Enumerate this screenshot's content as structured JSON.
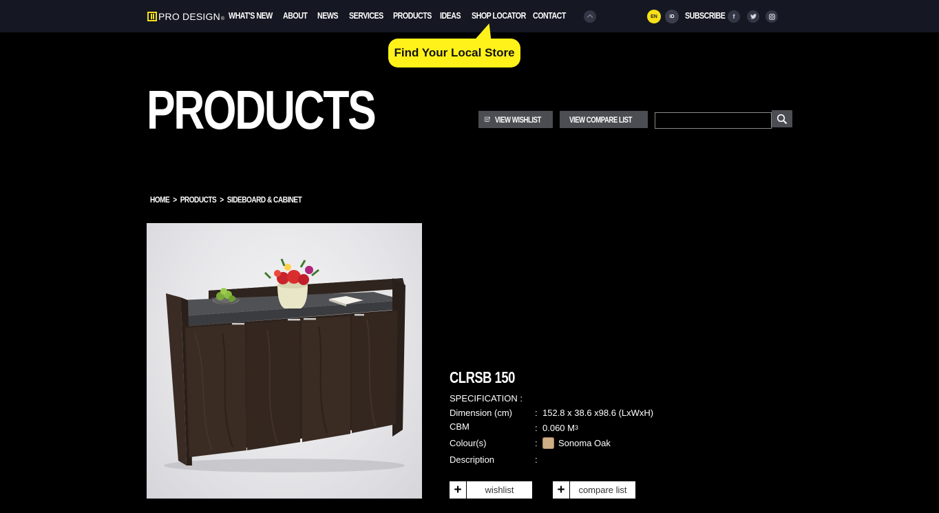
{
  "brand": {
    "logo_text": "PRO DESIGN",
    "reg_mark": "®"
  },
  "nav": {
    "items": [
      "WHAT'S NEW",
      "ABOUT",
      "NEWS",
      "SERVICES",
      "PRODUCTS",
      "IDEAS",
      "SHOP LOCATOR",
      "CONTACT"
    ],
    "lang_en": "EN",
    "lang_id": "ID",
    "subscribe": "SUBSCRIBE",
    "social": {
      "facebook": "f",
      "twitter": "t",
      "instagram": "◘"
    }
  },
  "tooltip": "Find Your Local Store",
  "header": {
    "title": "PRODUCTS",
    "view_wishlist": "VIEW WISHLIST",
    "view_compare": "VIEW COMPARE LIST",
    "search_value": ""
  },
  "breadcrumb": [
    "HOME",
    ">",
    "PRODUCTS",
    ">",
    "SIDEBOARD & CABINET"
  ],
  "product": {
    "name": "CLRSB 150",
    "spec_heading": "SPECIFICATION :",
    "dimension_label": "Dimension (cm)",
    "dimension_value": "152.8 x 38.6 x98.6 (LxWxH)",
    "cbm_label": "CBM",
    "cbm_value": "0.060 M",
    "cbm_sup": "3",
    "colour_label": "Colour(s)",
    "colour_value": "Sonoma Oak",
    "description_label": "Description",
    "description_value": "",
    "colon": ":",
    "wishlist_btn": "wishlist",
    "compare_btn": "compare list",
    "plus": "+"
  },
  "colors": {
    "accent": "#f7e017",
    "nav_bg": "#151822",
    "button_bg": "#4c4d52"
  }
}
